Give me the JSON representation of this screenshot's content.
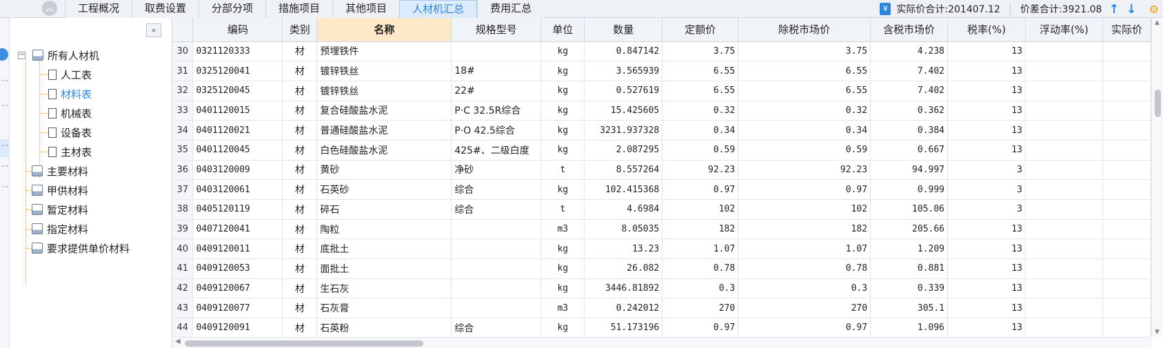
{
  "tabs": [
    {
      "label": "工程概况",
      "active": false
    },
    {
      "label": "取费设置",
      "active": false
    },
    {
      "label": "分部分项",
      "active": false
    },
    {
      "label": "措施项目",
      "active": false
    },
    {
      "label": "其他项目",
      "active": false
    },
    {
      "label": "人材机汇总",
      "active": true
    },
    {
      "label": "费用汇总",
      "active": false
    }
  ],
  "summary": {
    "actual_total": "实际价合计:201407.12",
    "price_diff_total": "价差合计:3921.08"
  },
  "tree": {
    "root": "所有人材机",
    "children": [
      "人工表",
      "材料表",
      "机械表",
      "设备表",
      "主材表"
    ],
    "selected": "材料表",
    "groups": [
      "主要材料",
      "甲供材料",
      "暂定材料",
      "指定材料",
      "要求提供单价材料"
    ]
  },
  "grid": {
    "columns": [
      "编码",
      "类别",
      "名称",
      "规格型号",
      "单位",
      "数量",
      "定额价",
      "除税市场价",
      "含税市场价",
      "税率(%)",
      "浮动率(%)",
      "实际价"
    ],
    "highlight_column": "名称",
    "rows": [
      {
        "no": "30",
        "code": "0321120333",
        "type": "材",
        "name": "预埋铁件",
        "spec": "",
        "unit": "kg",
        "qty": "0.847142",
        "quota": "3.75",
        "market_ex": "3.75",
        "market_in": "4.238",
        "tax": "13",
        "float": ""
      },
      {
        "no": "31",
        "code": "0325120041",
        "type": "材",
        "name": "镀锌铁丝",
        "spec": "18#",
        "unit": "kg",
        "qty": "3.565939",
        "quota": "6.55",
        "market_ex": "6.55",
        "market_in": "7.402",
        "tax": "13",
        "float": ""
      },
      {
        "no": "32",
        "code": "0325120045",
        "type": "材",
        "name": "镀锌铁丝",
        "spec": "22#",
        "unit": "kg",
        "qty": "0.527619",
        "quota": "6.55",
        "market_ex": "6.55",
        "market_in": "7.402",
        "tax": "13",
        "float": ""
      },
      {
        "no": "33",
        "code": "0401120015",
        "type": "材",
        "name": "复合硅酸盐水泥",
        "spec": "P·C 32.5R综合",
        "unit": "kg",
        "qty": "15.425605",
        "quota": "0.32",
        "market_ex": "0.32",
        "market_in": "0.362",
        "tax": "13",
        "float": ""
      },
      {
        "no": "34",
        "code": "0401120021",
        "type": "材",
        "name": "普通硅酸盐水泥",
        "spec": "P·O 42.5综合",
        "unit": "kg",
        "qty": "3231.937328",
        "quota": "0.34",
        "market_ex": "0.34",
        "market_in": "0.384",
        "tax": "13",
        "float": ""
      },
      {
        "no": "35",
        "code": "0401120045",
        "type": "材",
        "name": "白色硅酸盐水泥",
        "spec": "425#、二级白度",
        "unit": "kg",
        "qty": "2.087295",
        "quota": "0.59",
        "market_ex": "0.59",
        "market_in": "0.667",
        "tax": "13",
        "float": ""
      },
      {
        "no": "36",
        "code": "0403120009",
        "type": "材",
        "name": "黄砂",
        "spec": "净砂",
        "unit": "t",
        "qty": "8.557264",
        "quota": "92.23",
        "market_ex": "92.23",
        "market_in": "94.997",
        "tax": "3",
        "float": ""
      },
      {
        "no": "37",
        "code": "0403120061",
        "type": "材",
        "name": "石英砂",
        "spec": "综合",
        "unit": "kg",
        "qty": "102.415368",
        "quota": "0.97",
        "market_ex": "0.97",
        "market_in": "0.999",
        "tax": "3",
        "float": ""
      },
      {
        "no": "38",
        "code": "0405120119",
        "type": "材",
        "name": "碎石",
        "spec": "综合",
        "unit": "t",
        "qty": "4.6984",
        "quota": "102",
        "market_ex": "102",
        "market_in": "105.06",
        "tax": "3",
        "float": ""
      },
      {
        "no": "39",
        "code": "0407120041",
        "type": "材",
        "name": "陶粒",
        "spec": "",
        "unit": "m3",
        "qty": "8.05035",
        "quota": "182",
        "market_ex": "182",
        "market_in": "205.66",
        "tax": "13",
        "float": ""
      },
      {
        "no": "40",
        "code": "0409120011",
        "type": "材",
        "name": "底批土",
        "spec": "",
        "unit": "kg",
        "qty": "13.23",
        "quota": "1.07",
        "market_ex": "1.07",
        "market_in": "1.209",
        "tax": "13",
        "float": ""
      },
      {
        "no": "41",
        "code": "0409120053",
        "type": "材",
        "name": "面批土",
        "spec": "",
        "unit": "kg",
        "qty": "26.082",
        "quota": "0.78",
        "market_ex": "0.78",
        "market_in": "0.881",
        "tax": "13",
        "float": ""
      },
      {
        "no": "42",
        "code": "0409120067",
        "type": "材",
        "name": "生石灰",
        "spec": "",
        "unit": "kg",
        "qty": "3446.81892",
        "quota": "0.3",
        "market_ex": "0.3",
        "market_in": "0.339",
        "tax": "13",
        "float": ""
      },
      {
        "no": "43",
        "code": "0409120077",
        "type": "材",
        "name": "石灰膏",
        "spec": "",
        "unit": "m3",
        "qty": "0.242012",
        "quota": "270",
        "market_ex": "270",
        "market_in": "305.1",
        "tax": "13",
        "float": ""
      },
      {
        "no": "44",
        "code": "0409120091",
        "type": "材",
        "name": "石英粉",
        "spec": "综合",
        "unit": "kg",
        "qty": "51.173196",
        "quota": "0.97",
        "market_ex": "0.97",
        "market_in": "1.096",
        "tax": "13",
        "float": ""
      }
    ]
  },
  "icons": {
    "collapse_top": "double-chevron-up-icon",
    "tree_collapse": "double-chevron-left-icon",
    "sort_up": "arrow-up-icon",
    "sort_down": "arrow-down-icon",
    "settings": "gear-icon"
  },
  "colors": {
    "accent": "#2f86d6",
    "header_bg": "#f0f3f7",
    "highlight_header": "#fde8c8",
    "tree_line": "#f0a000"
  }
}
